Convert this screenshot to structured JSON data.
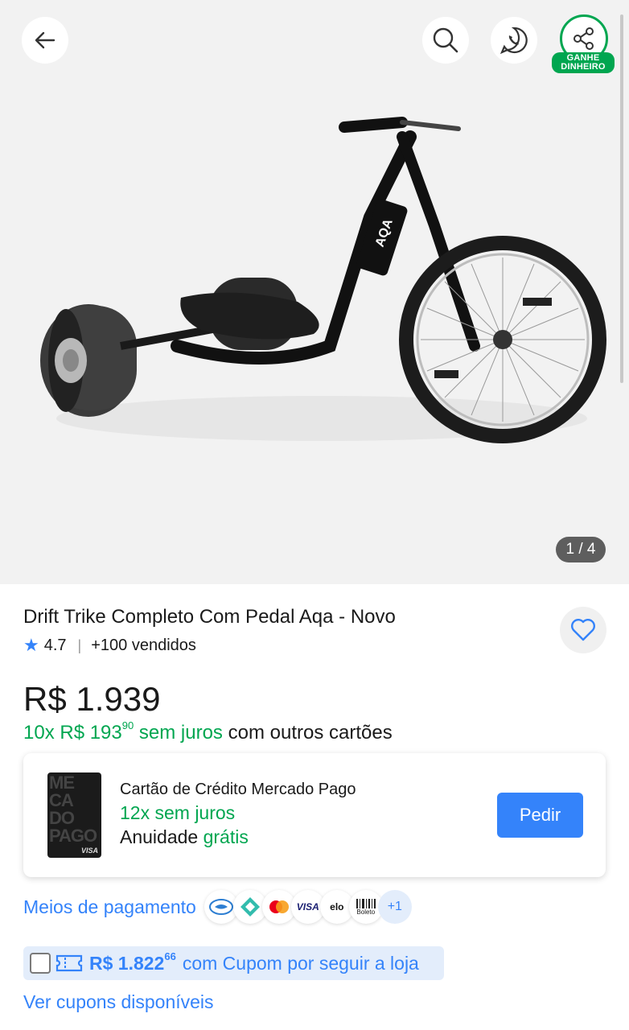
{
  "gallery": {
    "counter": "1 / 4",
    "share_badge": "GANHE DINHEIRO",
    "product_logo_text": "AQA"
  },
  "product": {
    "title": "Drift Trike Completo Com Pedal Aqa - Novo",
    "rating": "4.7",
    "sold": "+100 vendidos",
    "price": "R$ 1.939",
    "installments_prefix": "10x R$ 193",
    "installments_cents": "90",
    "installments_green_suffix": "sem juros",
    "installments_suffix": "com outros cartões"
  },
  "card_offer": {
    "card_letters": "ME CA DO PAGO",
    "card_brand": "VISA",
    "title": "Cartão de Crédito Mercado Pago",
    "installments": "12x sem juros",
    "fee_label": "Anuidade",
    "fee_value": "grátis",
    "button_label": "Pedir"
  },
  "payment": {
    "link_label": "Meios de pagamento",
    "methods": [
      "mercado-pago",
      "pix",
      "mastercard",
      "VISA",
      "elo",
      "Boleto"
    ],
    "more_label": "+1"
  },
  "coupon": {
    "amount": "R$ 1.822",
    "amount_cents": "66",
    "text": "com Cupom por seguir a loja",
    "see_coupons_label": "Ver cupons disponíveis"
  },
  "colors": {
    "accent_blue": "#3483fa",
    "green": "#00a650",
    "gallery_bg": "#f2f2f2"
  }
}
